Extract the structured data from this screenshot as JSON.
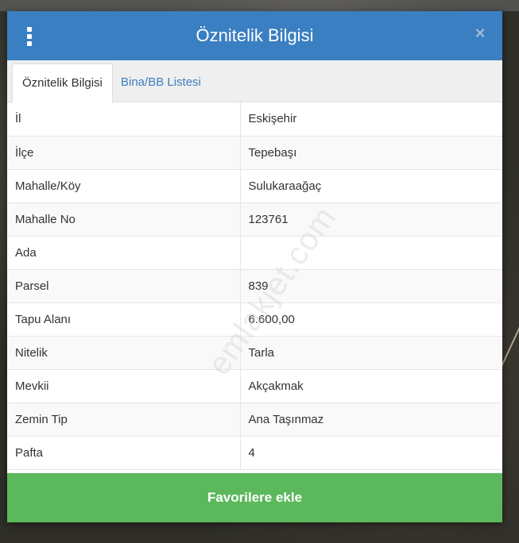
{
  "modal": {
    "title": "Öznitelik Bilgisi",
    "close_icon": "×"
  },
  "tabs": [
    {
      "label": "Öznitelik Bilgisi",
      "active": true
    },
    {
      "label": "Bina/BB Listesi",
      "active": false
    }
  ],
  "rows": [
    {
      "key": "İl",
      "value": "Eskişehir"
    },
    {
      "key": "İlçe",
      "value": "Tepebaşı"
    },
    {
      "key": "Mahalle/Köy",
      "value": "Sulukaraağaç"
    },
    {
      "key": "Mahalle No",
      "value": "123761"
    },
    {
      "key": "Ada",
      "value": ""
    },
    {
      "key": "Parsel",
      "value": "839"
    },
    {
      "key": "Tapu Alanı",
      "value": "6.600,00"
    },
    {
      "key": "Nitelik",
      "value": "Tarla"
    },
    {
      "key": "Mevkii",
      "value": "Akçakmak"
    },
    {
      "key": "Zemin Tip",
      "value": "Ana Taşınmaz"
    },
    {
      "key": "Pafta",
      "value": "4"
    }
  ],
  "watermark": "emlakjet.com",
  "favorite_button": "Favorilere ekle",
  "colors": {
    "header": "#3a7fc1",
    "button": "#5cb85c",
    "tab_link": "#3a7fc1"
  }
}
